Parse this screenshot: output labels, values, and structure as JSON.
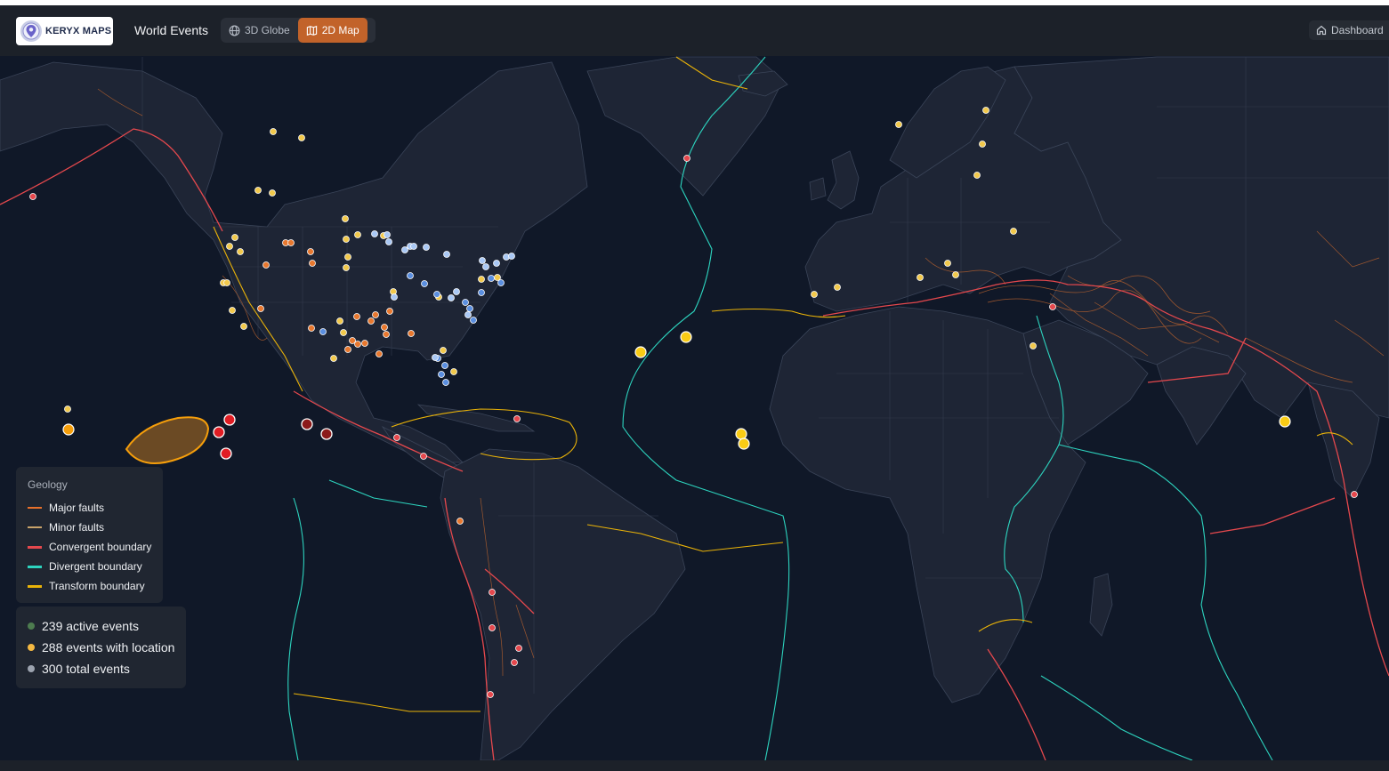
{
  "app": {
    "logo_text": "KERYX MAPS",
    "title": "World Events"
  },
  "view_toggle": {
    "globe_label": "3D Globe",
    "map_label": "2D Map",
    "active": "2D Map"
  },
  "nav": {
    "dashboard_label": "Dashboard"
  },
  "legend": {
    "title": "Geology",
    "items": [
      {
        "label": "Major faults",
        "color": "#e8702a"
      },
      {
        "label": "Minor faults",
        "color": "#c9a36a"
      },
      {
        "label": "Convergent boundary",
        "color": "#e5484d"
      },
      {
        "label": "Divergent boundary",
        "color": "#2dd4bf"
      },
      {
        "label": "Transform boundary",
        "color": "#eab308"
      }
    ]
  },
  "stats": [
    {
      "label": "239 active events",
      "color": "#4d7c4f"
    },
    {
      "label": "288 events with location",
      "color": "#f5b942"
    },
    {
      "label": "300 total events",
      "color": "#9ca3af"
    }
  ],
  "colors": {
    "land": "#1e2535",
    "ocean": "#101828",
    "accent": "#c2632a",
    "event_yellow": "#f2c94c",
    "event_orange": "#e8782f",
    "event_blue": "#5b8fe0",
    "event_lightblue": "#a9c8f5",
    "event_red": "#e5484d",
    "event_darkred": "#b91c1c"
  }
}
